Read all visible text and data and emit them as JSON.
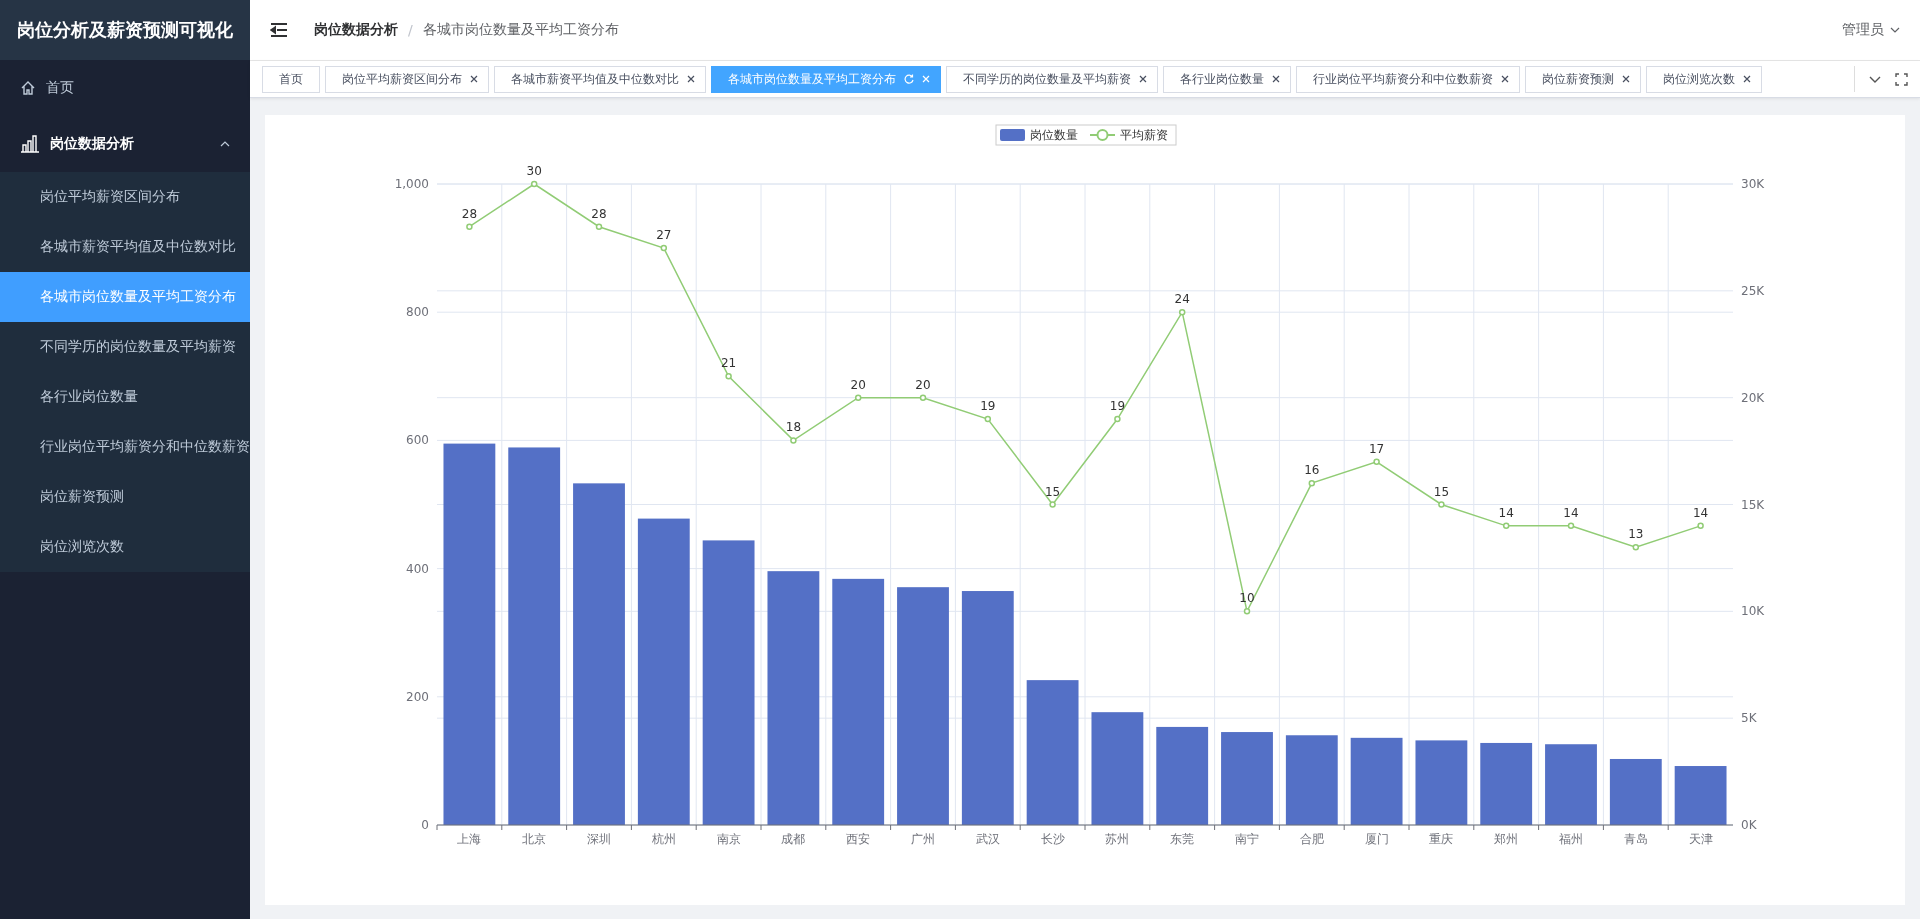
{
  "sidebar": {
    "title": "岗位分析及薪资预测可视化",
    "items": [
      {
        "label": "首页",
        "kind": "link"
      },
      {
        "label": "岗位数据分析",
        "kind": "group",
        "expanded": true,
        "children": [
          {
            "label": "岗位平均薪资区间分布",
            "selected": false
          },
          {
            "label": "各城市薪资平均值及中位数对比",
            "selected": false
          },
          {
            "label": "各城市岗位数量及平均工资分布",
            "selected": true
          },
          {
            "label": "不同学历的岗位数量及平均薪资",
            "selected": false
          },
          {
            "label": "各行业岗位数量",
            "selected": false
          },
          {
            "label": "行业岗位平均薪资分和中位数薪资",
            "selected": false
          },
          {
            "label": "岗位薪资预测",
            "selected": false
          },
          {
            "label": "岗位浏览次数",
            "selected": false
          }
        ]
      }
    ]
  },
  "header": {
    "breadcrumb": [
      "岗位数据分析",
      "各城市岗位数量及平均工资分布"
    ],
    "separator": "/",
    "user": "管理员"
  },
  "tabs": [
    {
      "label": "首页",
      "selected": false,
      "closable": false
    },
    {
      "label": "岗位平均薪资区间分布",
      "selected": false,
      "closable": true
    },
    {
      "label": "各城市薪资平均值及中位数对比",
      "selected": false,
      "closable": true
    },
    {
      "label": "各城市岗位数量及平均工资分布",
      "selected": true,
      "closable": true
    },
    {
      "label": "不同学历的岗位数量及平均薪资",
      "selected": false,
      "closable": true
    },
    {
      "label": "各行业岗位数量",
      "selected": false,
      "closable": true
    },
    {
      "label": "行业岗位平均薪资分和中位数薪资",
      "selected": false,
      "closable": true
    },
    {
      "label": "岗位薪资预测",
      "selected": false,
      "closable": true
    },
    {
      "label": "岗位浏览次数",
      "selected": false,
      "closable": true
    }
  ],
  "chart_data": {
    "type": "bar",
    "categories": [
      "上海",
      "北京",
      "深圳",
      "杭州",
      "南京",
      "成都",
      "西安",
      "广州",
      "武汉",
      "长沙",
      "苏州",
      "东莞",
      "南宁",
      "合肥",
      "厦门",
      "重庆",
      "郑州",
      "福州",
      "青岛",
      "天津"
    ],
    "series": [
      {
        "name": "岗位数量",
        "color": "#5470c6",
        "values": [
          595,
          589,
          533,
          478,
          444,
          396,
          384,
          371,
          365,
          226,
          176,
          153,
          145,
          140,
          136,
          132,
          128,
          126,
          103,
          92
        ]
      },
      {
        "name": "平均薪资",
        "color": "#91cc75",
        "type": "line",
        "axis": "y2",
        "marker": "circle",
        "values": [
          28,
          30,
          28,
          27,
          21,
          18,
          20,
          20,
          19,
          15,
          19,
          24,
          10,
          16,
          17,
          15,
          14,
          14,
          13,
          14
        ],
        "value_labels": [
          "28",
          "30",
          "28",
          "27",
          "21",
          "18",
          "20",
          "20",
          "19",
          "15",
          "19",
          "24",
          "10",
          "16",
          "17",
          "15",
          "14",
          "14",
          "13",
          "14"
        ]
      }
    ],
    "grid": true,
    "legend": "top",
    "ylim": [
      0,
      1000
    ],
    "yticks": [
      {
        "value": 0,
        "label": "0"
      },
      {
        "value": 200,
        "label": "200"
      },
      {
        "value": 400,
        "label": "400"
      },
      {
        "value": 600,
        "label": "600"
      },
      {
        "value": 800,
        "label": "800"
      },
      {
        "value": 1000,
        "label": "1,000"
      }
    ],
    "y2lim": [
      0,
      30
    ],
    "y2ticks": [
      {
        "value": 0,
        "label": "0K"
      },
      {
        "value": 5,
        "label": "5K"
      },
      {
        "value": 10,
        "label": "10K"
      },
      {
        "value": 15,
        "label": "15K"
      },
      {
        "value": 20,
        "label": "20K"
      },
      {
        "value": 25,
        "label": "25K"
      },
      {
        "value": 30,
        "label": "30K"
      }
    ]
  }
}
